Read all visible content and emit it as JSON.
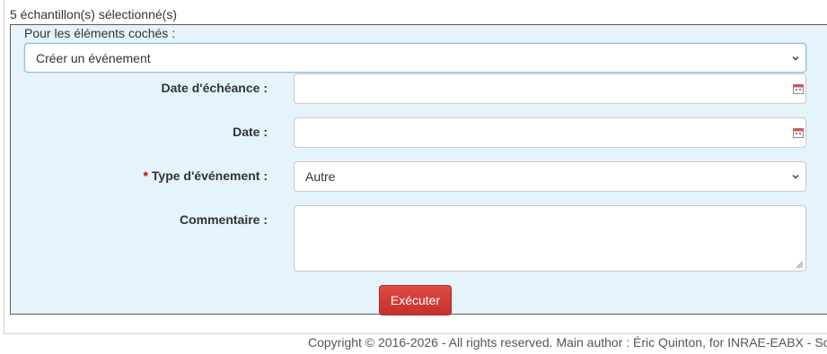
{
  "selection": {
    "count_text": "5 échantillon(s) sélectionné(s)"
  },
  "panel": {
    "legend": "Pour les éléments cochés :",
    "action_select": {
      "selected": "Créer un événement"
    },
    "fields": {
      "due_date": {
        "label": "Date d'échéance :",
        "value": ""
      },
      "date": {
        "label": "Date :",
        "value": ""
      },
      "event_type": {
        "label": "Type d'événement :",
        "required_marker": "*",
        "selected": "Autre"
      },
      "comment": {
        "label": "Commentaire :",
        "value": ""
      }
    },
    "execute_label": "Exécuter"
  },
  "footer": {
    "copyright": "Copyright © 2016-2026 - All rights reserved. Main author : Éric Quinton, for INRAE-EABX - So"
  },
  "colors": {
    "panel_bg": "#e5f3fb",
    "button_red": "#d9534f",
    "required_red": "#cc0000"
  },
  "icons": [
    "chevron-down-icon",
    "calendar-icon",
    "resize-grip-icon"
  ]
}
